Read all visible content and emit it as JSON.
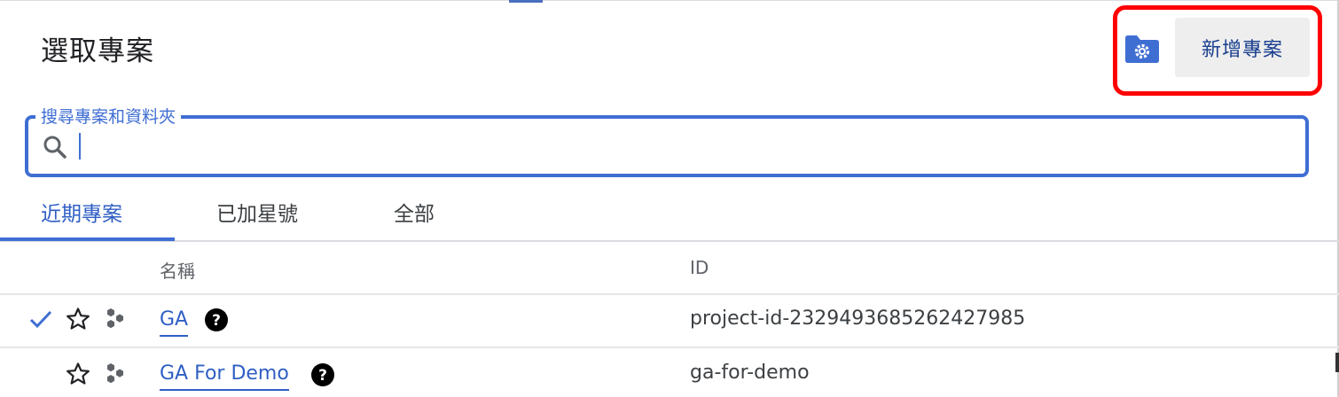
{
  "dialog": {
    "title": "選取專案",
    "new_project_label": "新增專案",
    "folder_settings_icon": "folder-settings-icon"
  },
  "search": {
    "label": "搜尋專案和資料夾",
    "value": "",
    "icon": "search-icon"
  },
  "tabs": [
    {
      "label": "近期專案",
      "active": true
    },
    {
      "label": "已加星號",
      "active": false
    },
    {
      "label": "全部",
      "active": false
    }
  ],
  "table": {
    "columns": [
      "名稱",
      "ID"
    ],
    "rows": [
      {
        "selected": true,
        "name": "GA",
        "id": "project-id-2329493685262427985"
      },
      {
        "selected": false,
        "name": "GA For Demo",
        "id": "ga-for-demo"
      }
    ]
  },
  "colors": {
    "accent": "#3f6ed3",
    "highlight": "#ff0000",
    "link": "#2f5fc4"
  }
}
